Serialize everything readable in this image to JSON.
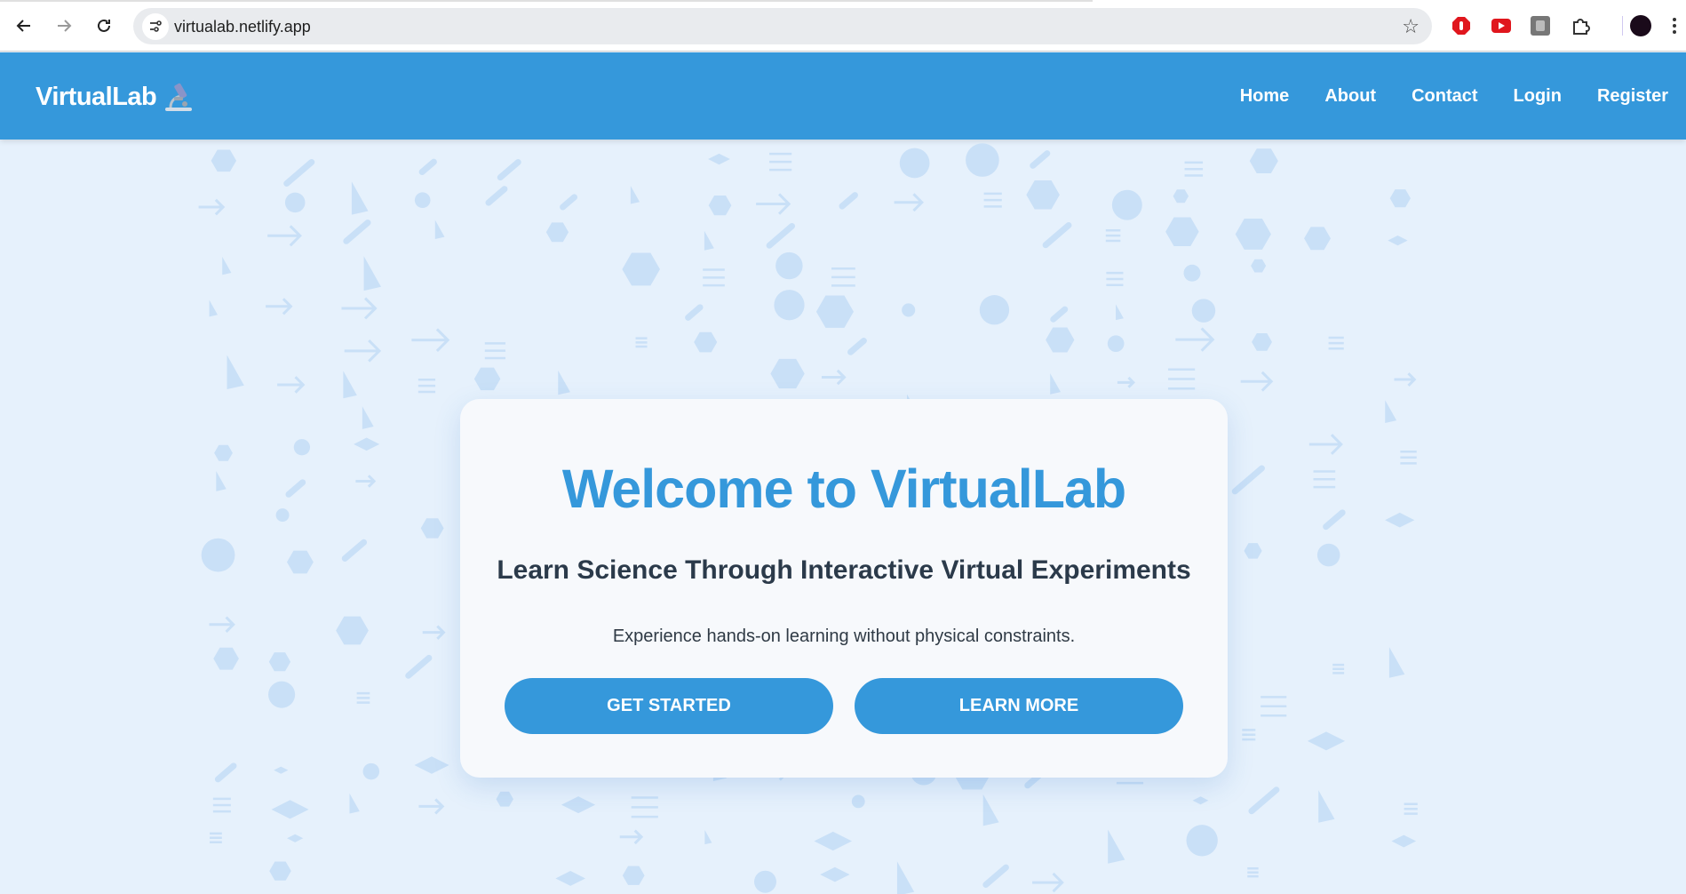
{
  "browser": {
    "url": "virtualab.netlify.app",
    "icons": [
      "back-icon",
      "forward-icon",
      "reload-icon",
      "site-info-icon",
      "bookmark-star-icon",
      "extension-red-icon",
      "extension-youtube-icon",
      "extension-gray-icon",
      "extensions-puzzle-icon",
      "profile-avatar",
      "menu-dots-icon"
    ]
  },
  "header": {
    "brand": "VirtualLab",
    "brand_icon": "microscope-icon",
    "nav": [
      "Home",
      "About",
      "Contact",
      "Login",
      "Register"
    ]
  },
  "hero": {
    "title": "Welcome to VirtualLab",
    "subtitle": "Learn Science Through Interactive Virtual Experiments",
    "description": "Experience hands-on learning without physical constraints.",
    "primary_button": "GET STARTED",
    "secondary_button": "LEARN MORE"
  },
  "colors": {
    "primary": "#3598db",
    "page_background": "#e6f1fc",
    "card_background": "#f7f9fc",
    "heading_text": "#2b3a4a",
    "pattern": "#c9e0f7"
  }
}
